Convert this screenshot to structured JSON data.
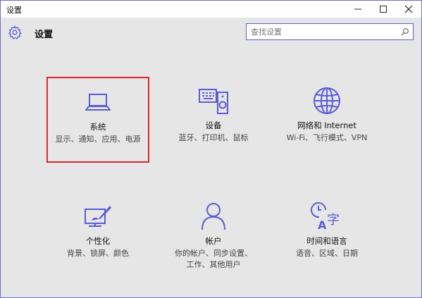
{
  "window": {
    "title": "设置"
  },
  "header": {
    "title": "设置"
  },
  "search": {
    "placeholder": "查找设置"
  },
  "tiles": [
    {
      "name": "系统",
      "desc": "显示、通知、应用、电源",
      "icon": "laptop-icon"
    },
    {
      "name": "设备",
      "desc": "蓝牙、打印机、鼠标",
      "icon": "devices-icon"
    },
    {
      "name": "网络和 Internet",
      "desc": "Wi-Fi、飞行模式、VPN",
      "icon": "globe-icon"
    },
    {
      "name": "个性化",
      "desc": "背景、锁屏、颜色",
      "icon": "personalization-icon"
    },
    {
      "name": "帐户",
      "desc": "你的帐户、同步设置、工作、其他用户",
      "icon": "person-icon"
    },
    {
      "name": "时间和语言",
      "desc": "语音、区域、日期",
      "icon": "time-language-icon"
    }
  ],
  "colors": {
    "accent": "#5b5bd6",
    "selection": "#e0262d",
    "background": "#e6e6e6"
  }
}
